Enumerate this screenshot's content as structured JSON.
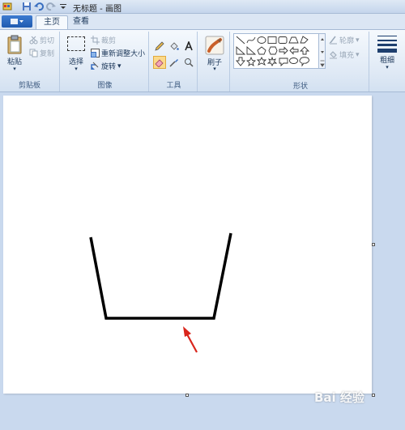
{
  "window": {
    "title": "无标题 - 画图"
  },
  "quick_access": {
    "icons": [
      "app-icon",
      "save-icon",
      "undo-icon",
      "redo-icon",
      "customize-icon"
    ]
  },
  "tabs": [
    {
      "label": "主页",
      "active": true
    },
    {
      "label": "查看",
      "active": false
    }
  ],
  "clipboard": {
    "paste_label": "粘贴",
    "cut_label": "剪切",
    "copy_label": "复制",
    "group_label": "剪贴板"
  },
  "image": {
    "select_label": "选择",
    "crop_label": "裁剪",
    "resize_label": "重新调整大小",
    "rotate_label": "旋转",
    "group_label": "图像"
  },
  "tools": {
    "group_label": "工具",
    "items": [
      "pencil-icon",
      "fill-icon",
      "text-icon",
      "eraser-icon",
      "color-picker-icon",
      "magnifier-icon"
    ],
    "selected": "eraser-icon"
  },
  "brushes": {
    "label": "刷子"
  },
  "shapes": {
    "group_label": "形状",
    "outline_label": "轮廓",
    "fill_label": "填充"
  },
  "size": {
    "label": "粗细"
  },
  "watermark": {
    "text": "Bai 经验"
  },
  "colors": {
    "stroke": "#000000",
    "arrow": "#d9251c",
    "ribbon_bg": "#dfe9f5",
    "workspace": "#c9d9ee"
  }
}
